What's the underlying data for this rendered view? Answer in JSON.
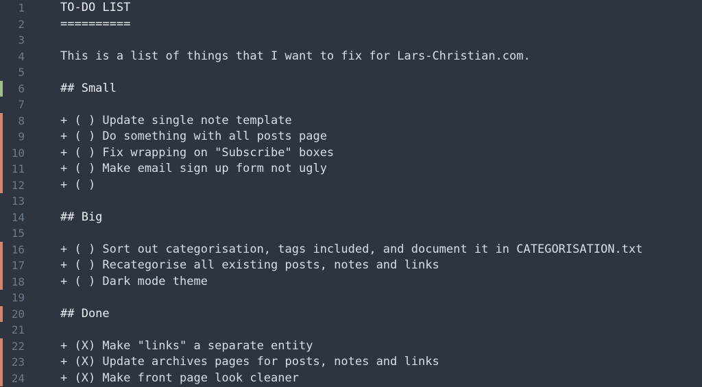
{
  "lines": [
    {
      "no": 1,
      "marker": "none",
      "cls": "title",
      "text": "TO-DO LIST"
    },
    {
      "no": 2,
      "marker": "none",
      "cls": "underline",
      "text": "=========="
    },
    {
      "no": 3,
      "marker": "none",
      "cls": "text",
      "text": ""
    },
    {
      "no": 4,
      "marker": "none",
      "cls": "text",
      "text": "This is a list of things that I want to fix for Lars-Christian.com."
    },
    {
      "no": 5,
      "marker": "none",
      "cls": "text",
      "text": ""
    },
    {
      "no": 6,
      "marker": "green",
      "cls": "heading",
      "text": "## Small"
    },
    {
      "no": 7,
      "marker": "none",
      "cls": "text",
      "text": ""
    },
    {
      "no": 8,
      "marker": "orange",
      "cls": "task",
      "text": "+ ( ) Update single note template"
    },
    {
      "no": 9,
      "marker": "orange",
      "cls": "task",
      "text": "+ ( ) Do something with all posts page"
    },
    {
      "no": 10,
      "marker": "orange",
      "cls": "task",
      "text": "+ ( ) Fix wrapping on \"Subscribe\" boxes"
    },
    {
      "no": 11,
      "marker": "orange",
      "cls": "task",
      "text": "+ ( ) Make email sign up form not ugly"
    },
    {
      "no": 12,
      "marker": "orange",
      "cls": "task",
      "text": "+ ( )"
    },
    {
      "no": 13,
      "marker": "none",
      "cls": "text",
      "text": ""
    },
    {
      "no": 14,
      "marker": "none",
      "cls": "heading",
      "text": "## Big"
    },
    {
      "no": 15,
      "marker": "none",
      "cls": "text",
      "text": ""
    },
    {
      "no": 16,
      "marker": "orange",
      "cls": "task",
      "text": "+ ( ) Sort out categorisation, tags included, and document it in CATEGORISATION.txt"
    },
    {
      "no": 17,
      "marker": "orange",
      "cls": "task",
      "text": "+ ( ) Recategorise all existing posts, notes and links"
    },
    {
      "no": 18,
      "marker": "orange",
      "cls": "task",
      "text": "+ ( ) Dark mode theme"
    },
    {
      "no": 19,
      "marker": "none",
      "cls": "text",
      "text": ""
    },
    {
      "no": 20,
      "marker": "orange",
      "cls": "heading",
      "text": "## Done"
    },
    {
      "no": 21,
      "marker": "none",
      "cls": "text",
      "text": ""
    },
    {
      "no": 22,
      "marker": "orange",
      "cls": "task",
      "text": "+ (X) Make \"links\" a separate entity"
    },
    {
      "no": 23,
      "marker": "orange",
      "cls": "task",
      "text": "+ (X) Update archives pages for posts, notes and links"
    },
    {
      "no": 24,
      "marker": "orange",
      "cls": "task",
      "text": "+ (X) Make front page look cleaner"
    }
  ]
}
